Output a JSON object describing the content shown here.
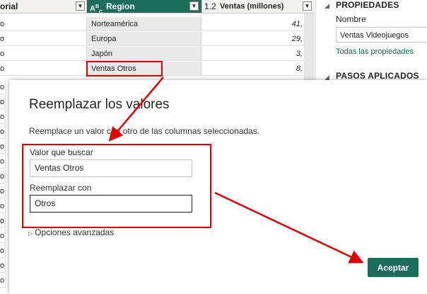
{
  "grid": {
    "col1_header": "orial",
    "col2_header": "Region",
    "col2_type_icon": "A",
    "col2_type_icon_sub": "B",
    "col2_type_icon_sub2": "C",
    "col3_header": "Ventas (millones)",
    "col3_type_icon": "1.2",
    "rows": [
      {
        "c1": "o",
        "region": "Norteamérica",
        "ventas": "41,"
      },
      {
        "c1": "o",
        "region": "Europa",
        "ventas": "29,"
      },
      {
        "c1": "o",
        "region": "Japón",
        "ventas": "3,"
      },
      {
        "c1": "o",
        "region": "Ventas Otros",
        "ventas": "8,"
      }
    ],
    "extra_left": [
      "o",
      "o",
      "o",
      "o",
      "o",
      "o",
      "o",
      "o",
      "o",
      "o",
      "o",
      "o",
      "o",
      "o"
    ]
  },
  "pane": {
    "properties_heading": "PROPIEDADES",
    "name_label": "Nombre",
    "name_value": "Ventas Videojuegos",
    "all_props_link": "Todas las propiedades",
    "steps_heading": "PASOS APLICADOS"
  },
  "dialog": {
    "title": "Reemplazar los valores",
    "description": "Reemplace un valor con otro de las columnas seleccionadas.",
    "find_label": "Valor que buscar",
    "find_value": "Ventas Otros",
    "replace_label": "Reemplazar con",
    "replace_value": "Otros",
    "advanced_label": "Opciones avanzadas",
    "ok_label": "Aceptar"
  },
  "colors": {
    "accent": "#1a6e5a",
    "annotation": "#e00000"
  }
}
